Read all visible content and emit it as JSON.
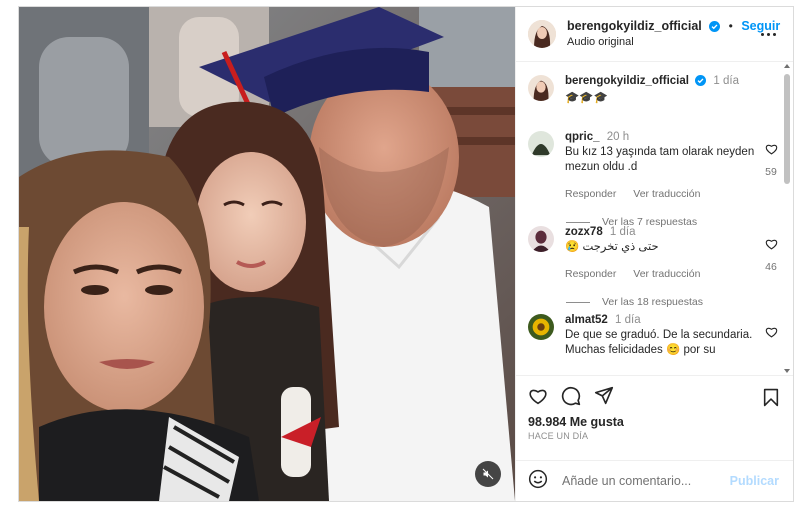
{
  "post": {
    "account": "berengokyildiz_official",
    "follow_label": "Seguir",
    "dot": "•",
    "audio": "Audio original",
    "caption_time": "1 día",
    "caption_emojis": "🎓🎓🎓",
    "likes": "98.984 Me gusta",
    "posted_ago": "HACE UN DÍA"
  },
  "comments": [
    {
      "user": "qpric_",
      "time": "20 h",
      "text": "Bu kız 13 yaşında tam olarak neyden mezun oldu .d",
      "reply": "Responder",
      "translate": "Ver traducción",
      "likes": "59",
      "replies": "Ver las 7 respuestas",
      "avatar_color": "#2f3a2a"
    },
    {
      "user": "zozx78",
      "time": "1 día",
      "text": "😢 حتى ذي تخرجت",
      "reply": "Responder",
      "translate": "Ver traducción",
      "likes": "46",
      "replies": "Ver las 18 respuestas",
      "avatar_color": "#5b2b3a"
    },
    {
      "user": "almat52",
      "time": "1 día",
      "text": "De que se graduó. De la secundaria. Muchas felicidades 😊 por su",
      "avatar_color": "#d9a400"
    }
  ],
  "compose": {
    "placeholder": "Añade un comentario...",
    "publish": "Publicar"
  },
  "colors": {
    "accent": "#0095f6",
    "publish_disabled": "#b3dbff",
    "verified": "#0095f6"
  }
}
